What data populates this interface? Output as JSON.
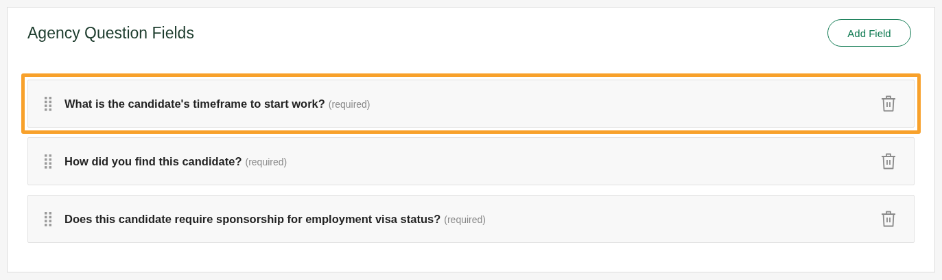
{
  "panel": {
    "title": "Agency Question Fields",
    "add_button": "Add Field"
  },
  "fields": [
    {
      "question": "What is the candidate's timeframe to start work?",
      "note": "(required)",
      "highlighted": true
    },
    {
      "question": "How did you find this candidate?",
      "note": "(required)",
      "highlighted": false
    },
    {
      "question": "Does this candidate require sponsorship for employment visa status?",
      "note": "(required)",
      "highlighted": false
    }
  ]
}
